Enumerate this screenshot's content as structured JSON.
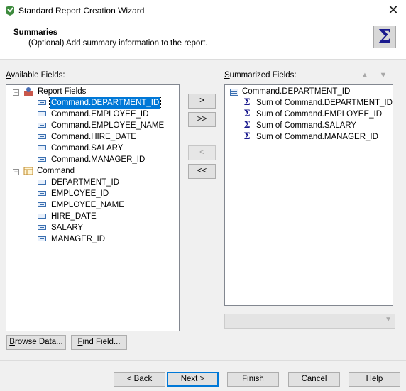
{
  "window": {
    "title": "Standard Report Creation Wizard"
  },
  "header": {
    "title": "Summaries",
    "subtitle": "(Optional) Add summary information to the report.",
    "icon": "sigma-icon"
  },
  "available": {
    "label": "Available Fields:",
    "report_fields_label": "Report Fields",
    "report_fields": [
      "Command.DEPARTMENT_ID",
      "Command.EMPLOYEE_ID",
      "Command.EMPLOYEE_NAME",
      "Command.HIRE_DATE",
      "Command.SALARY",
      "Command.MANAGER_ID"
    ],
    "selected_item": "Command.DEPARTMENT_ID",
    "command_label": "Command",
    "command_fields": [
      "DEPARTMENT_ID",
      "EMPLOYEE_ID",
      "EMPLOYEE_NAME",
      "HIRE_DATE",
      "SALARY",
      "MANAGER_ID"
    ]
  },
  "move_buttons": {
    "add": ">",
    "add_all": ">>",
    "remove": "<",
    "remove_all": "<<"
  },
  "summarized": {
    "label": "Summarized Fields:",
    "group": "Command.DEPARTMENT_ID",
    "items": [
      "Sum of Command.DEPARTMENT_ID",
      "Sum of Command.EMPLOYEE_ID",
      "Sum of Command.SALARY",
      "Sum of Command.MANAGER_ID"
    ]
  },
  "actions": {
    "browse": "Browse Data...",
    "find": "Find Field..."
  },
  "footer": {
    "back": "< Back",
    "next": "Next >",
    "finish": "Finish",
    "cancel": "Cancel",
    "help": "Help"
  }
}
